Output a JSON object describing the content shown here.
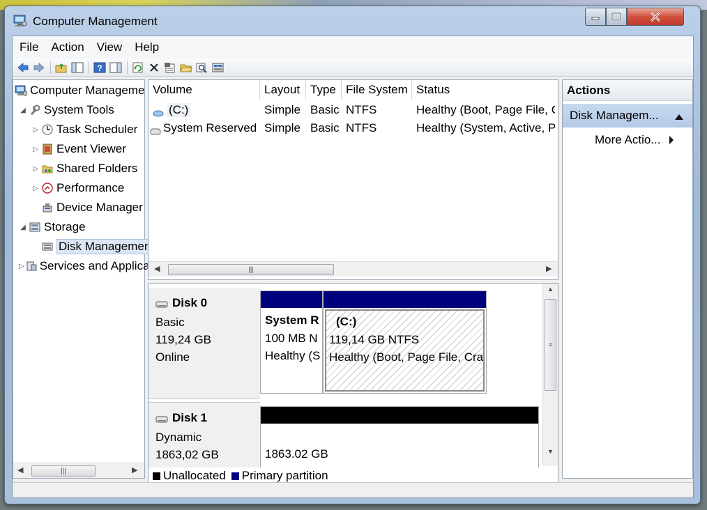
{
  "window": {
    "title": "Computer Management"
  },
  "menu": [
    "File",
    "Action",
    "View",
    "Help"
  ],
  "tree": {
    "root": "Computer Management",
    "system_tools": "System Tools",
    "task_scheduler": "Task Scheduler",
    "event_viewer": "Event Viewer",
    "shared_folders": "Shared Folders",
    "performance": "Performance",
    "device_manager": "Device Manager",
    "storage": "Storage",
    "disk_management": "Disk Management",
    "services": "Services and Applications"
  },
  "volume_table": {
    "columns": [
      "Volume",
      "Layout",
      "Type",
      "File System",
      "Status"
    ],
    "rows": [
      {
        "volume": "(C:)",
        "layout": "Simple",
        "type": "Basic",
        "fs": "NTFS",
        "status": "Healthy (Boot, Page File, C"
      },
      {
        "volume": "System Reserved",
        "layout": "Simple",
        "type": "Basic",
        "fs": "NTFS",
        "status": "Healthy (System, Active, P"
      }
    ]
  },
  "disks": {
    "disk0": {
      "name": "Disk 0",
      "type": "Basic",
      "size": "119,24 GB",
      "state": "Online",
      "partitions": [
        {
          "title": "System R",
          "size": "100 MB N",
          "status": "Healthy (S"
        },
        {
          "title": "(C:)",
          "size": "119,14 GB NTFS",
          "status": "Healthy (Boot, Page File, Cra"
        }
      ]
    },
    "disk1": {
      "name": "Disk 1",
      "type": "Dynamic",
      "size": "1863,02 GB",
      "partitions": [
        {
          "size": "1863.02 GB"
        }
      ]
    }
  },
  "legend": {
    "unallocated": "Unallocated",
    "primary": "Primary partition"
  },
  "actions": {
    "header": "Actions",
    "group": "Disk Managem...",
    "more": "More Actio..."
  },
  "colors": {
    "primary_partition": "#00007f",
    "unallocated": "#000000",
    "action_group": "#b3c9e6"
  }
}
